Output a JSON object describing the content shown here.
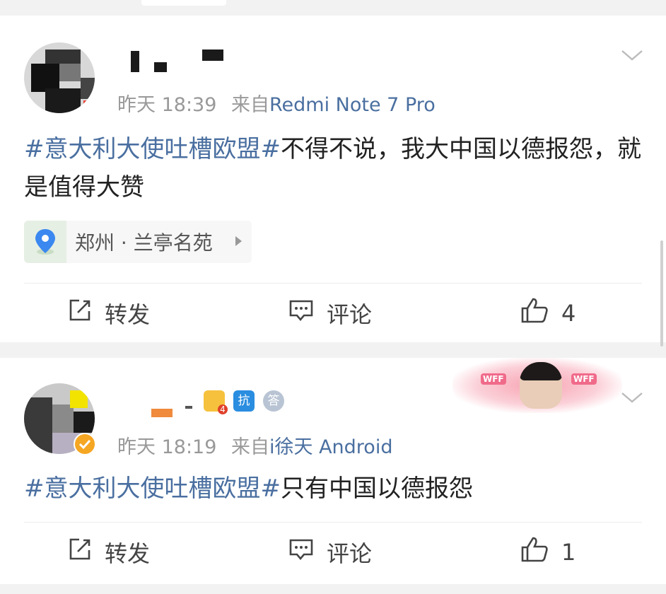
{
  "posts": [
    {
      "time": "昨天 18:39",
      "from_label": "来自",
      "source": "Redmi Note 7 Pro",
      "hashtag": "#意大利大使吐槽欧盟#",
      "text": "不得不说，我大中国以德报怨，就是值得大赞",
      "location": "郑州 · 兰亭名苑",
      "actions": {
        "repost": "转发",
        "comment": "评论",
        "like_count": "4"
      }
    },
    {
      "time": "昨天 18:19",
      "from_label": "来自",
      "source": "i徐天 Android",
      "hashtag": "#意大利大使吐槽欧盟#",
      "text": "只有中国以德报怨",
      "badges": {
        "crown_level": "4",
        "kang": "抗",
        "da": "答"
      },
      "banner": {
        "tag1": "WFF",
        "tag2": "WFF"
      },
      "actions": {
        "repost": "转发",
        "comment": "评论",
        "like_count": "1"
      }
    }
  ],
  "icons": {
    "chevron": "chevron-down-icon",
    "location": "location-pin-icon",
    "repost": "repost-icon",
    "comment": "comment-icon",
    "like": "thumbs-up-icon",
    "verified": "verified-badge-icon"
  },
  "colors": {
    "link": "#4a6fa0",
    "meta": "#999999",
    "text": "#222222",
    "verified": "#f5a623"
  }
}
